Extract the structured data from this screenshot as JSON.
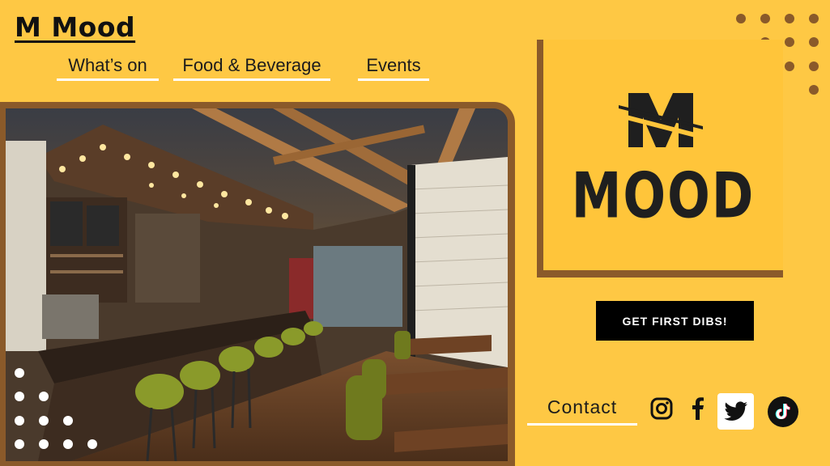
{
  "brand": {
    "name": "M Mood"
  },
  "nav": {
    "items": [
      {
        "label": "What’s on"
      },
      {
        "label": "Food & Beverage"
      },
      {
        "label": "Events"
      }
    ]
  },
  "logo": {
    "word": "MOOD",
    "monogram": "M"
  },
  "cta": {
    "label": "GET FIRST DIBS!"
  },
  "contact": {
    "label": "Contact"
  },
  "social": [
    {
      "icon": "instagram-icon"
    },
    {
      "icon": "facebook-icon"
    },
    {
      "icon": "twitter-icon"
    },
    {
      "icon": "tiktok-icon"
    }
  ],
  "colors": {
    "background": "#fec844",
    "frame": "#8a5a2a",
    "cta_bg": "#000000",
    "text": "#1c1c1c"
  }
}
